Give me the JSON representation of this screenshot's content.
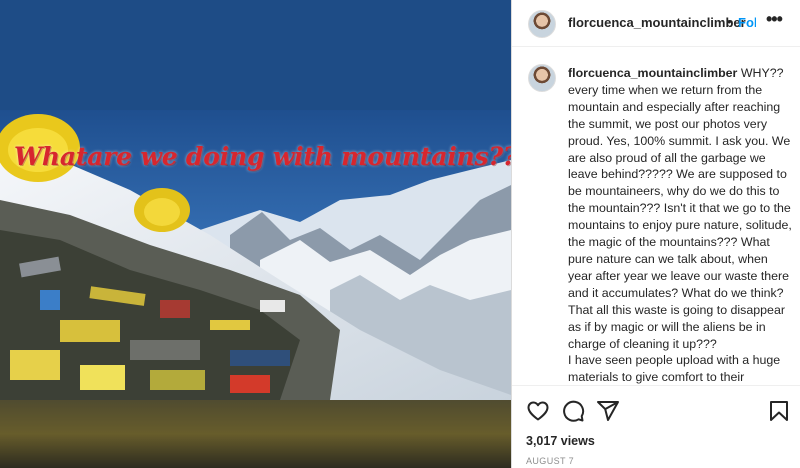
{
  "post": {
    "overlay_text": "Whatare we doing with mountains??",
    "author": {
      "username": "florcuenca_mountainclimber",
      "separator": "•",
      "follow_label": "Follow"
    },
    "more_icon": "more-horizontal-icon",
    "caption": {
      "username": "florcuenca_mountainclimber",
      "text": " WHY?? every time when we return from the mountain and especially after reaching the summit, we post our photos very proud. Yes, 100% summit. I ask you. We are also proud of all the garbage we leave behind????? We are supposed to be mountaineers, why do we do this to the mountain??? Isn't it that we go to the mountains to enjoy pure nature, solitude, the magic of the mountains??? What pure nature can we talk about, when year after year we leave our waste there and it accumulates? What do we think? That all this waste is going to disappear as if by magic or will the aliens be in charge of cleaning it up???\nI have seen people upload with a huge materials to give comfort to their customers. They spend a lot of"
    },
    "actions": {
      "like_icon": "heart-icon",
      "comment_icon": "comment-icon",
      "share_icon": "paper-plane-icon",
      "save_icon": "bookmark-icon"
    },
    "views": "3,017 views",
    "date": "AUGUST 7"
  },
  "colors": {
    "follow": "#0095f6",
    "overlay_text": "#d7262e",
    "text": "#262626",
    "muted": "#8e8e8e"
  }
}
